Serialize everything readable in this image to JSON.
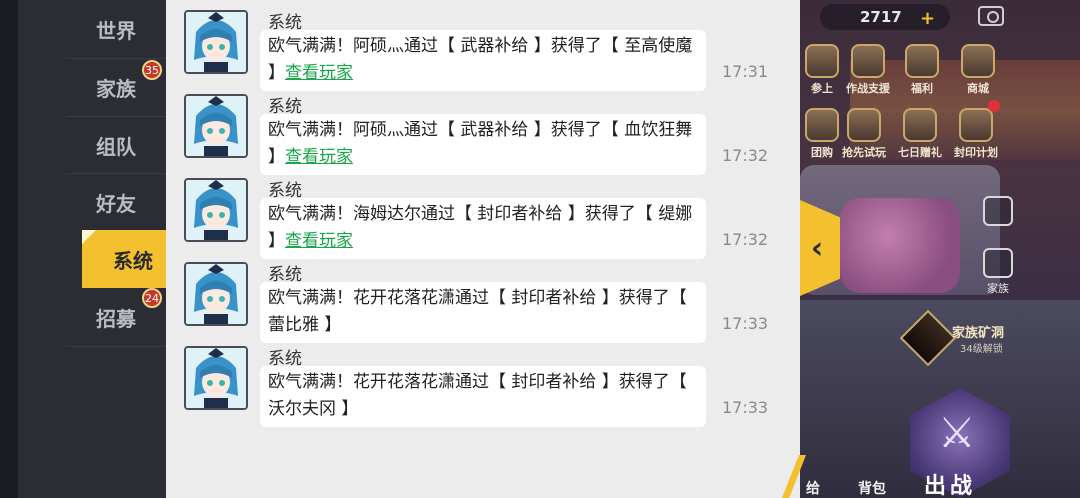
{
  "tabs": [
    {
      "label": "世界"
    },
    {
      "label": "家族",
      "badge": "35"
    },
    {
      "label": "组队"
    },
    {
      "label": "好友"
    },
    {
      "label": "系统",
      "active": true
    },
    {
      "label": "招募",
      "badge": "24"
    }
  ],
  "messages": [
    {
      "sender": "系统",
      "text": "欧气满满！阿硕灬通过【 武器补给 】获得了【 至高使魔 】",
      "link": "查看玩家",
      "time": "17:31"
    },
    {
      "sender": "系统",
      "text": "欧气满满！阿硕灬通过【 武器补给 】获得了【 血饮狂舞 】",
      "link": "查看玩家",
      "time": "17:32"
    },
    {
      "sender": "系统",
      "text": "欧气满满！海姆达尔通过【 封印者补给 】获得了【 缇娜 】",
      "link": "查看玩家",
      "time": "17:32"
    },
    {
      "sender": "系统",
      "text": "欧气满满！花开花落花潇通过【 封印者补给 】获得了【 蕾比雅 】",
      "time": "17:33"
    },
    {
      "sender": "系统",
      "text": "欧气满满！花开花落花潇通过【 封印者补给 】获得了【 沃尔夫冈 】",
      "time": "17:33"
    }
  ],
  "hud": {
    "currency": "2717",
    "plus": "+"
  },
  "menu": {
    "row1": [
      "参上",
      "作战支援",
      "福利",
      "商城"
    ],
    "row2": [
      "团购",
      "抢先试玩",
      "七日赠礼",
      "封印计划"
    ]
  },
  "side": {
    "btn1": "",
    "btn2": "家族"
  },
  "mine": {
    "title": "家族矿洞",
    "subtitle": "34级解锁"
  },
  "bottom": {
    "left": "给",
    "bag": "背包",
    "fight": "出战"
  },
  "collapse_icon": "chevron-left-icon",
  "colors": {
    "accent": "#f3c02f",
    "link": "#19a64a",
    "badge": "#c0392b"
  }
}
